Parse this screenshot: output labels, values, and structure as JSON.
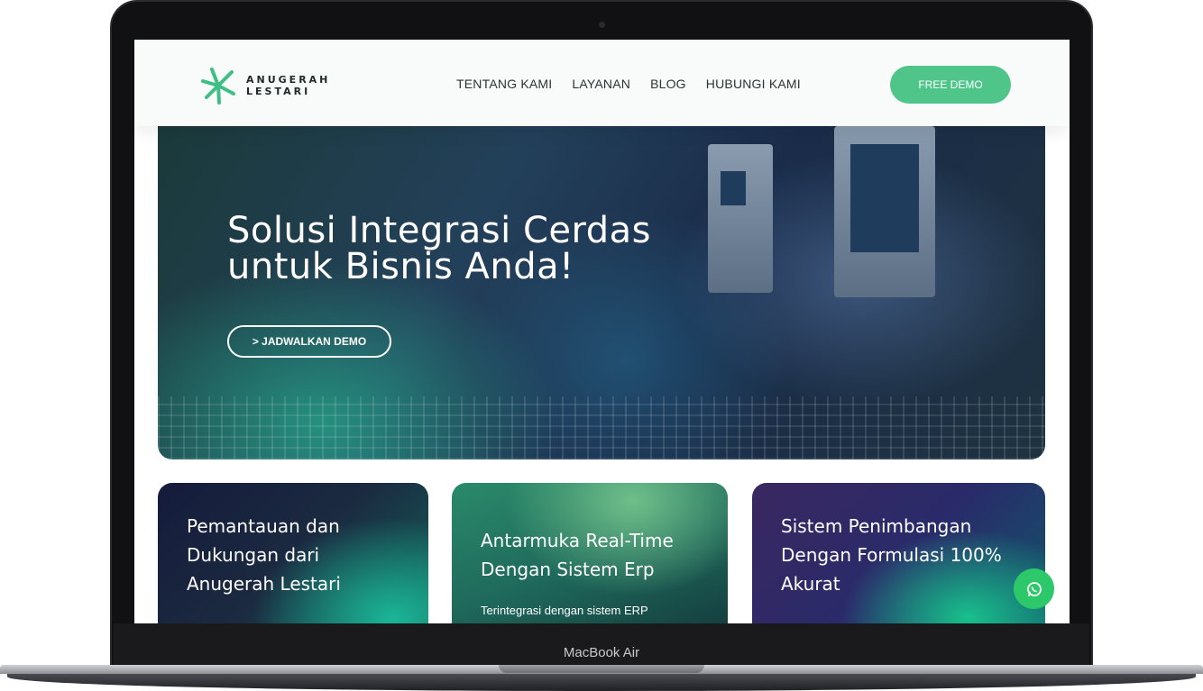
{
  "device": {
    "model_label": "MacBook Air"
  },
  "header": {
    "logo_line1": "ANUGERAH",
    "logo_line2": "LESTARI",
    "nav": [
      "TENTANG KAMI",
      "LAYANAN",
      "BLOG",
      "HUBUNGI KAMI"
    ],
    "cta_label": "FREE DEMO"
  },
  "hero": {
    "title_line1": "Solusi Integrasi Cerdas",
    "title_line2": "untuk Bisnis Anda!",
    "cta_label": "> JADWALKAN DEMO"
  },
  "cards": [
    {
      "title": "Pemantauan dan Dukungan dari Anugerah Lestari",
      "text": ""
    },
    {
      "title": "Antarmuka Real-Time Dengan Sistem Erp",
      "text": "Terintegrasi dengan sistem ERP"
    },
    {
      "title": "Sistem Penimbangan Dengan Formulasi 100% Akurat",
      "text": ""
    }
  ],
  "colors": {
    "accent": "#4fc58a",
    "whatsapp": "#2dc86a"
  },
  "icons": {
    "logo": "anugerah-logo-icon",
    "whatsapp": "whatsapp-icon",
    "camera": "camera-icon"
  }
}
